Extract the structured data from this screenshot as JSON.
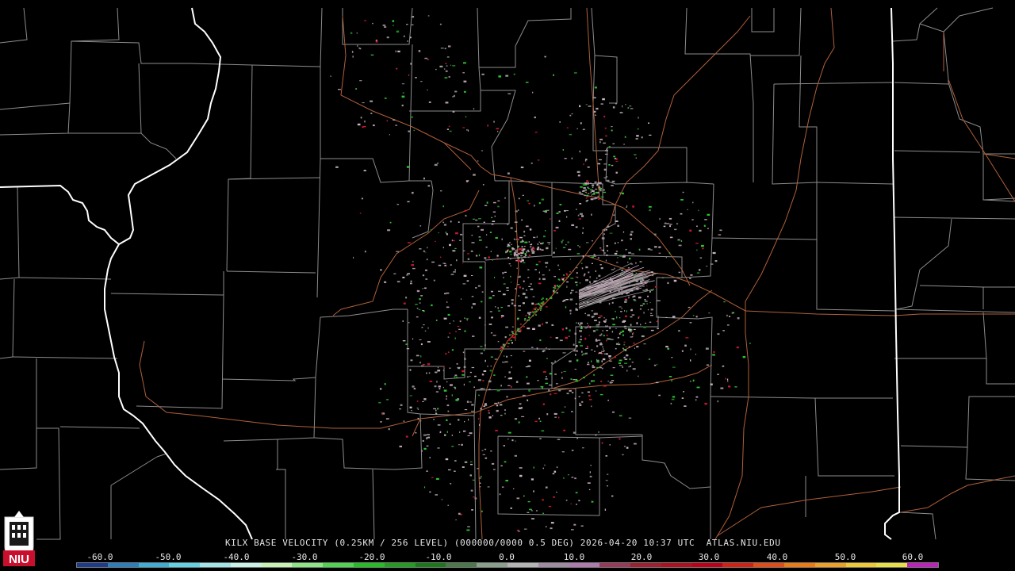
{
  "product": {
    "header": "KILX BASE VELOCITY (0.25KM / 256 LEVEL) (000000/0000 0.5 DEG) 2026-04-20 10:37 UTC  ATLAS.NIU.EDU"
  },
  "color_scale": {
    "ticks": [
      "-60.0",
      "-50.0",
      "-40.0",
      "-30.0",
      "-20.0",
      "-10.0",
      "0.0",
      "10.0",
      "20.0",
      "30.0",
      "40.0",
      "50.0",
      "60.0"
    ],
    "colors": [
      "#1e3c8c",
      "#2a7fbf",
      "#3ab0d8",
      "#5fd3e6",
      "#9ee6ea",
      "#c9f2e6",
      "#c8f2b4",
      "#8ce682",
      "#4cd64c",
      "#20c020",
      "#1ea01e",
      "#1a7a1a",
      "#4a7a4a",
      "#8aa08a",
      "#b4b4b4",
      "#a08ca0",
      "#b07ab0",
      "#9a3a5a",
      "#a02030",
      "#b01020",
      "#c00018",
      "#d82010",
      "#e84a10",
      "#f07a10",
      "#f0a020",
      "#f0c830",
      "#e8e040",
      "#c020c0"
    ]
  },
  "branding": {
    "logo_text": "NIU"
  },
  "colors": {
    "background": "#000000",
    "county_line": "#8c8c8c",
    "state_line": "#ffffff",
    "highway": "#b0603a",
    "text": "#e6e6e6"
  }
}
